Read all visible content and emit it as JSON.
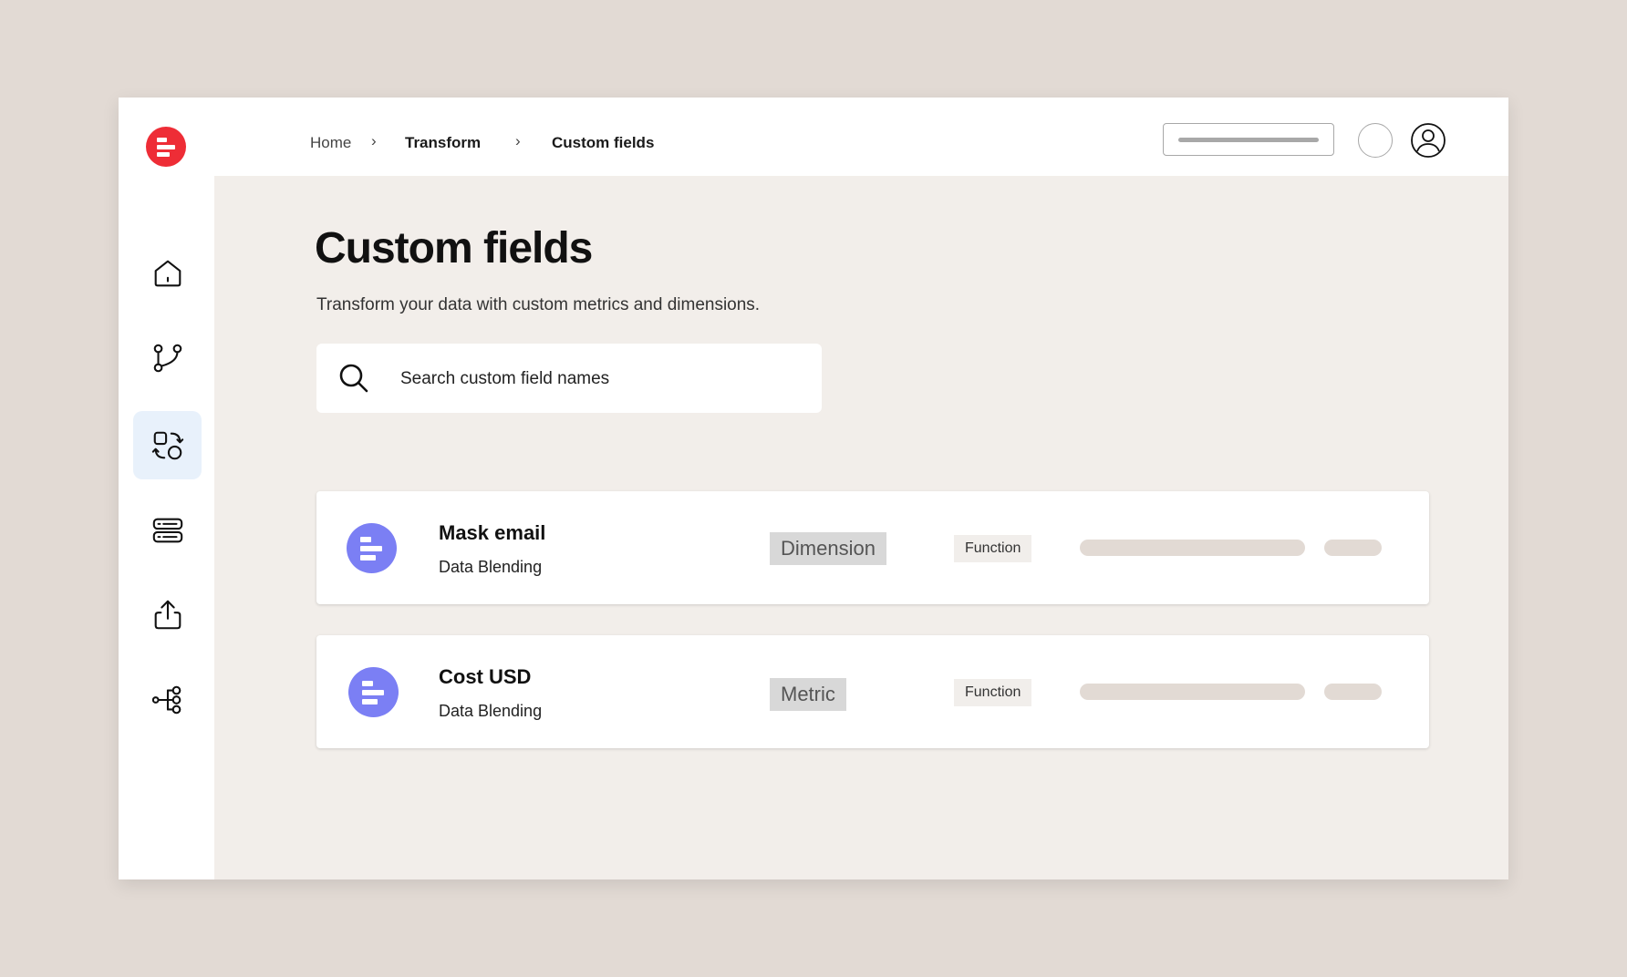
{
  "app": {
    "logo_icon": "brand-logo-icon",
    "brand_color": "#ee2d36"
  },
  "sidebar": {
    "items": [
      {
        "name": "home",
        "icon": "home-icon",
        "active": false
      },
      {
        "name": "workflows",
        "icon": "git-branch-icon",
        "active": false
      },
      {
        "name": "transform",
        "icon": "shapes-icon",
        "active": true
      },
      {
        "name": "sources",
        "icon": "server-icon",
        "active": false
      },
      {
        "name": "export",
        "icon": "upload-icon",
        "active": false
      },
      {
        "name": "destinations",
        "icon": "network-icon",
        "active": false
      }
    ]
  },
  "breadcrumb": {
    "home": "Home",
    "separator": "›",
    "transform": "Transform",
    "current": "Custom fields"
  },
  "page": {
    "title": "Custom fields",
    "subtitle": "Transform your data with custom metrics and dimensions."
  },
  "search": {
    "placeholder": "Search custom field names",
    "value": ""
  },
  "fields": [
    {
      "name": "Mask email",
      "source": "Data Blending",
      "type": "Dimension",
      "kind": "Function"
    },
    {
      "name": "Cost USD",
      "source": "Data Blending",
      "type": "Metric",
      "kind": "Function"
    }
  ],
  "colors": {
    "accent_active_bg": "#e8f1fb",
    "field_icon": "#7b7ff4",
    "main_bg": "#f2eeea"
  }
}
